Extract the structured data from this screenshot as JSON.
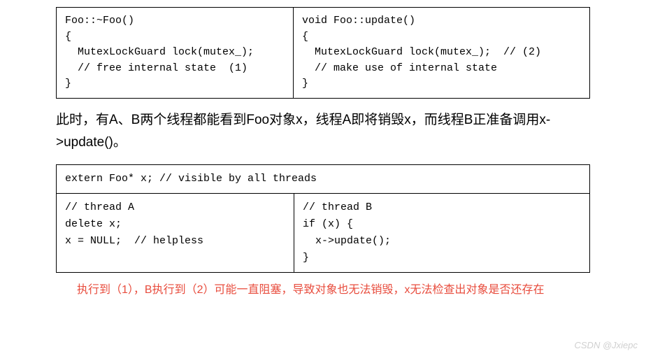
{
  "codeBlock1": {
    "left": "Foo::~Foo()\n{\n  MutexLockGuard lock(mutex_);\n  // free internal state  (1)\n}",
    "right": "void Foo::update()\n{\n  MutexLockGuard lock(mutex_);  // (2)\n  // make use of internal state\n}"
  },
  "paragraph": "此时，有A、B两个线程都能看到Foo对象x，线程A即将销毁x，而线程B正准备调用x->update()。",
  "table": {
    "header": "extern Foo* x; // visible by all threads",
    "leftCell": "// thread A\ndelete x;\nx = NULL;  // helpless",
    "rightCell": "// thread B\nif (x) {\n  x->update();\n}"
  },
  "annotation": "执行到（1），B执行到（2）可能一直阻塞，导致对象也无法销毁，x无法检查出对象是否还存在",
  "watermark": "CSDN @Jxiepc"
}
